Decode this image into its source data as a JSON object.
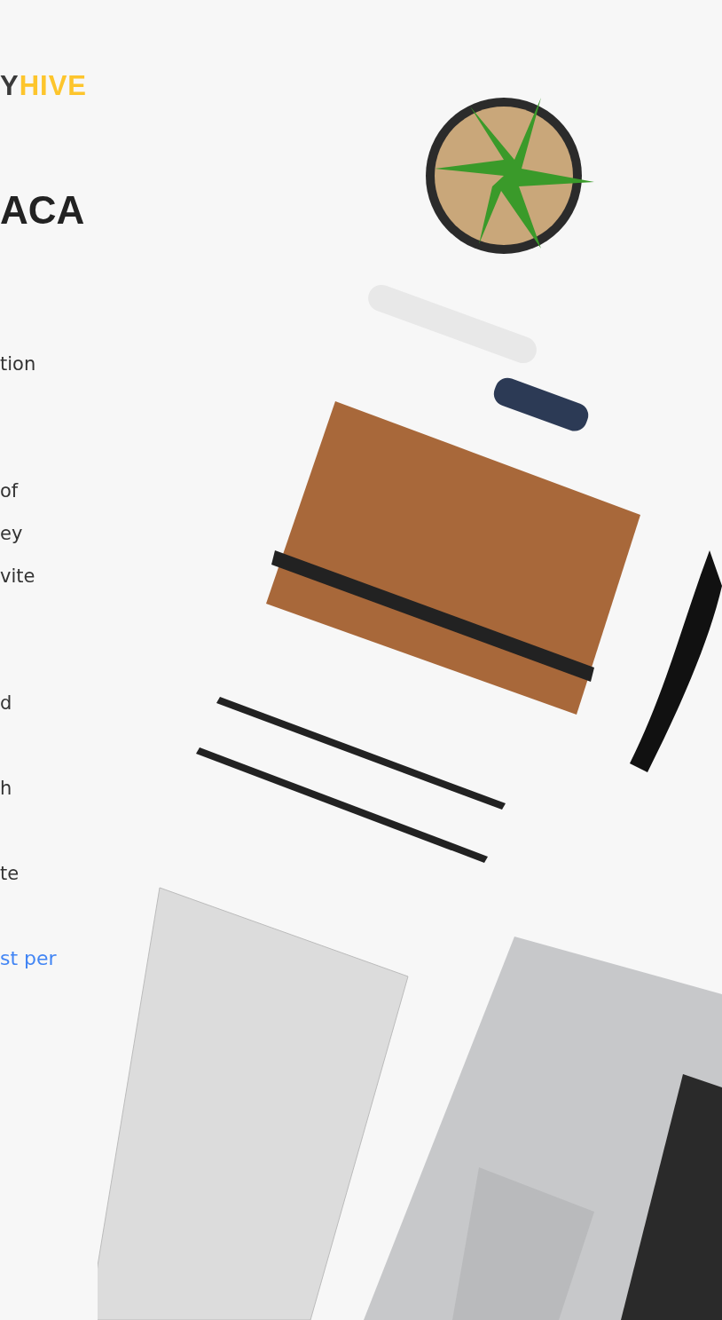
{
  "logo": {
    "dark": "Y",
    "accent": "HIVE"
  },
  "heading": "ACA",
  "paragraphs": [
    [
      "tion"
    ],
    [
      "of",
      "ey",
      "vite"
    ],
    [
      "d"
    ],
    [
      "h"
    ],
    [
      "te"
    ]
  ],
  "link": "st per"
}
